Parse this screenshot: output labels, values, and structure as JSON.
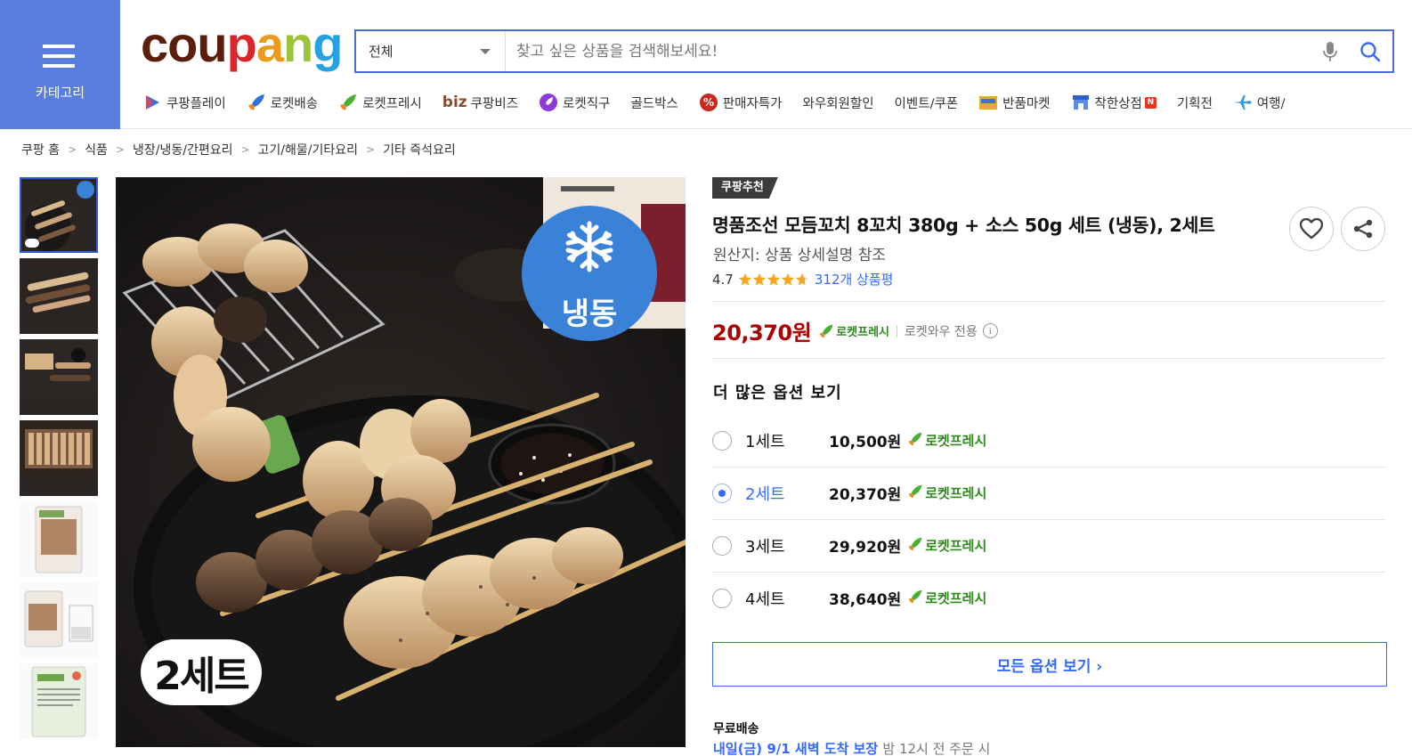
{
  "header": {
    "category_label": "카테고리",
    "search": {
      "scope": "전체",
      "placeholder": "찾고 싶은 상품을 검색해보세요!"
    },
    "nav": [
      {
        "label": "쿠팡플레이",
        "icon": "play-icon"
      },
      {
        "label": "로켓배송",
        "icon": "rocket-blue-icon"
      },
      {
        "label": "로켓프레시",
        "icon": "rocket-green-icon"
      },
      {
        "label": "쿠팡비즈",
        "prefix": "biz",
        "icon": "biz-logo"
      },
      {
        "label": "로켓직구",
        "icon": "rocket-purple-icon"
      },
      {
        "label": "골드박스",
        "icon": ""
      },
      {
        "label": "판매자특가",
        "icon": "percent-badge-icon"
      },
      {
        "label": "와우회원할인",
        "icon": ""
      },
      {
        "label": "이벤트/쿠폰",
        "icon": ""
      },
      {
        "label": "반품마켓",
        "icon": "box-icon"
      },
      {
        "label": "착한상점",
        "icon": "store-icon",
        "badge": "N"
      },
      {
        "label": "기획전",
        "icon": ""
      },
      {
        "label": "여행/",
        "icon": "airplane-icon"
      }
    ]
  },
  "breadcrumb": [
    "쿠팡 홈",
    "식품",
    "냉장/냉동/간편요리",
    "고기/해물/기타요리",
    "기타 즉석요리"
  ],
  "image": {
    "frozen_label": "냉동",
    "sets_label": "2세트"
  },
  "product": {
    "badge": "쿠팡추천",
    "title": "명품조선 모듬꼬치 8꼬치 380g + 소스 50g 세트 (냉동), 2세트",
    "origin": "원산지: 상품 상세설명 참조",
    "rating": "4.7",
    "rating_value": 4.7,
    "reviews": "312개 상품평",
    "price": "20,370원",
    "rocket_fresh": "로켓프레시",
    "wow_only": "로켓와우 전용",
    "more_options_title": "더 많은 옵션 보기",
    "options": [
      {
        "label": "1세트",
        "price": "10,500원",
        "tag": "로켓프레시",
        "selected": false
      },
      {
        "label": "2세트",
        "price": "20,370원",
        "tag": "로켓프레시",
        "selected": true
      },
      {
        "label": "3세트",
        "price": "29,920원",
        "tag": "로켓프레시",
        "selected": false
      },
      {
        "label": "4세트",
        "price": "38,640원",
        "tag": "로켓프레시",
        "selected": false
      }
    ],
    "all_options_btn": "모든 옵션 보기 ›",
    "shipping": "무료배송",
    "shipping_cut_highlight": "내일(금) 9/1 새벽 도착 보장",
    "shipping_cut_rest": "밤 12시 전 주문 시"
  },
  "colors": {
    "accent": "#346aff",
    "price": "#ae0000",
    "rocket_fresh": "#2f8a1e",
    "category_bg": "#5a7ee0"
  }
}
